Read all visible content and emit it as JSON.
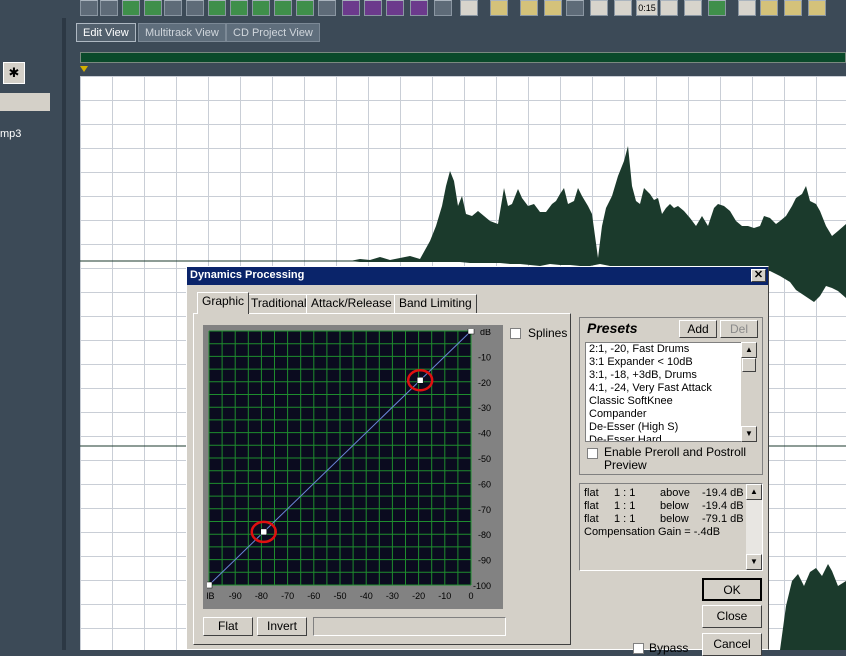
{
  "toolbar": {
    "buttons": [
      "undo-icon",
      "redo-icon",
      "cut-icon",
      "copy-icon",
      "paste-icon",
      "trim-icon",
      "mix-paste-icon",
      "paste-new-icon",
      "zoom-icon",
      "snap-icon",
      "waveform-icon",
      "spectral-icon",
      "metronome-icon",
      "time-selection-icon",
      "marquee-icon",
      "frequency-icon",
      "play-icon",
      "zoom-in-icon",
      "time-display-icon",
      "meters-icon",
      "settings-icon",
      "help-icon"
    ],
    "timecode_label": "0:15"
  },
  "left_panel": {
    "file_label": "mp3"
  },
  "view_tabs": [
    "Edit View",
    "Multitrack View",
    "CD Project View"
  ],
  "dialog": {
    "title": "Dynamics Processing",
    "close_label": "✕",
    "tabs": [
      "Graphic",
      "Traditional",
      "Attack/Release",
      "Band Limiting"
    ],
    "splines_label": "Splines",
    "graph": {
      "x_ticks": [
        "dB",
        "-90",
        "-80",
        "-70",
        "-60",
        "-50",
        "-40",
        "-30",
        "-20",
        "-10",
        "0"
      ],
      "y_ticks": [
        "dB",
        "-10",
        "-20",
        "-30",
        "-40",
        "-50",
        "-60",
        "-70",
        "-80",
        "-90",
        "-100"
      ],
      "curve_points_db": [
        [
          -100,
          -100
        ],
        [
          -79.1,
          -79.1
        ],
        [
          -19.4,
          -19.4
        ],
        [
          0,
          0
        ]
      ],
      "highlighted_points_db": [
        [
          -79.1,
          -79.1
        ],
        [
          -19.4,
          -19.4
        ]
      ],
      "line_color": "#6a86d8",
      "grid_color": "#1e8c2e",
      "background_color": "#0b0b1f"
    },
    "flat_label": "Flat",
    "invert_label": "Invert",
    "presets": {
      "heading": "Presets",
      "add_label": "Add",
      "del_label": "Del",
      "items": [
        "2:1, -20, Fast Drums",
        "3:1 Expander < 10dB",
        "3:1, -18, +3dB, Drums",
        "4:1, -24, Very Fast Attack",
        "Classic SoftKnee",
        "Compander",
        "De-Esser (High S)",
        "De-Esser Hard"
      ],
      "preroll_label": "Enable Preroll and Postroll Preview"
    },
    "info_lines": [
      [
        "flat",
        "1 : 1",
        "above",
        "-19.4 dB"
      ],
      [
        "flat",
        "1 : 1",
        "below",
        "-19.4 dB"
      ],
      [
        "flat",
        "1 : 1",
        "below",
        "-79.1 dB"
      ]
    ],
    "compensation": "Compensation Gain = -.4dB",
    "ok_label": "OK",
    "close_button_label": "Close",
    "cancel_label": "Cancel",
    "bypass_label": "Bypass"
  }
}
